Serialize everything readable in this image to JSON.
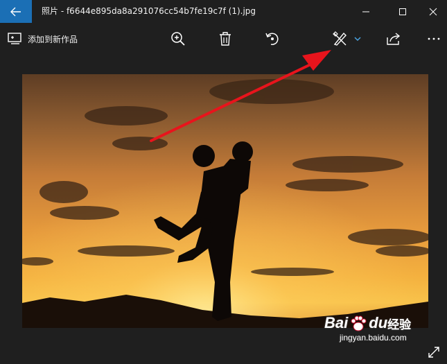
{
  "window": {
    "app_name": "照片",
    "file_name": "f6644e895da8a291076cc54b7fe19c7f (1).jpg",
    "title": "照片 - f6644e895da8a291076cc54b7fe19c7f (1).jpg"
  },
  "titlebar": {
    "back_icon": "arrow-left-icon",
    "controls": [
      "minimize-icon",
      "maximize-icon",
      "close-icon"
    ]
  },
  "toolbar": {
    "add_to_creation_label": "添加到新作品",
    "buttons": [
      "zoom-in-icon",
      "delete-icon",
      "rotate-icon",
      "edit-draw-icon",
      "share-icon",
      "more-icon"
    ],
    "dropdown_icon": "chevron-down-icon"
  },
  "colors": {
    "background": "#1f1f1f",
    "back_button": "#1b6fb5",
    "accent": "#4aa3e0",
    "annotation_arrow": "#e8141c"
  },
  "watermark": {
    "brand_latin_1": "Bai",
    "brand_latin_2": "du",
    "brand_cn": "经验",
    "url": "jingyan.baidu.com"
  }
}
